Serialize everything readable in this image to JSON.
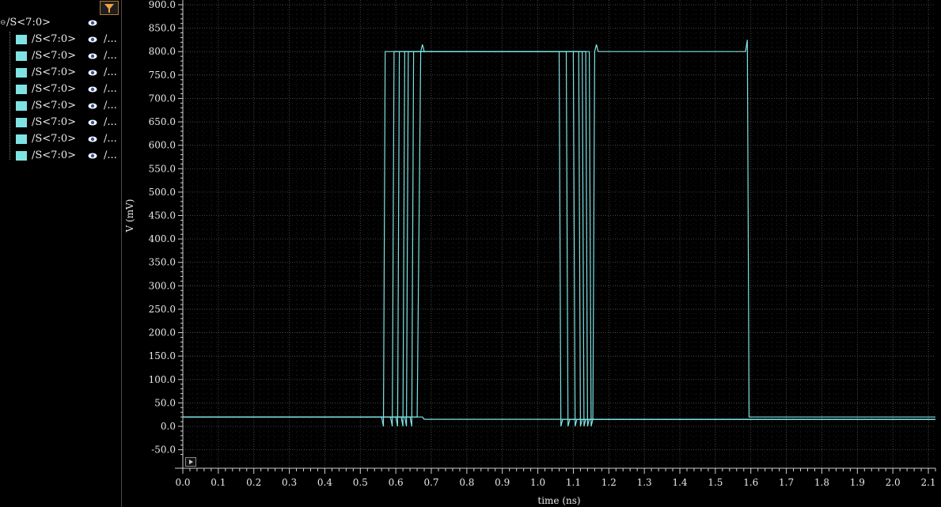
{
  "sidebar": {
    "parent": {
      "label": "/S<7:0>",
      "icon": "eye-icon"
    },
    "children": [
      {
        "label": "/S<7:0>",
        "path": "/...",
        "color": "#7fe3e3"
      },
      {
        "label": "/S<7:0>",
        "path": "/...",
        "color": "#7fe3e3"
      },
      {
        "label": "/S<7:0>",
        "path": "/...",
        "color": "#7fe3e3"
      },
      {
        "label": "/S<7:0>",
        "path": "/...",
        "color": "#7fe3e3"
      },
      {
        "label": "/S<7:0>",
        "path": "/...",
        "color": "#7fe3e3"
      },
      {
        "label": "/S<7:0>",
        "path": "/...",
        "color": "#7fe3e3"
      },
      {
        "label": "/S<7:0>",
        "path": "/...",
        "color": "#7fe3e3"
      },
      {
        "label": "/S<7:0>",
        "path": "/...",
        "color": "#7fe3e3"
      }
    ],
    "filter_icon": "filter-icon"
  },
  "chart_data": {
    "type": "line",
    "title": "",
    "xlabel": "time (ns)",
    "ylabel": "V (mV)",
    "xlim": [
      0.0,
      2.12
    ],
    "ylim": [
      -70,
      905
    ],
    "grid": true,
    "line_color": "#7fe3e3",
    "background": "#000000",
    "x_ticks": [
      0.0,
      0.1,
      0.2,
      0.3,
      0.4,
      0.5,
      0.6,
      0.7,
      0.8,
      0.9,
      1.0,
      1.1,
      1.2,
      1.3,
      1.4,
      1.5,
      1.6,
      1.7,
      1.8,
      1.9,
      2.0,
      2.1
    ],
    "x_tick_labels": [
      "0.0",
      "0.1",
      "0.2",
      "0.3",
      "0.4",
      "0.5",
      "0.6",
      "0.7",
      "0.8",
      "0.9",
      "1.0",
      "1.1",
      "1.2",
      "1.3",
      "1.4",
      "1.5",
      "1.6",
      "1.7",
      "1.8",
      "1.9",
      "2.0",
      "2.1"
    ],
    "y_ticks": [
      -50,
      0,
      50,
      100,
      150,
      200,
      250,
      300,
      350,
      400,
      450,
      500,
      550,
      600,
      650,
      700,
      750,
      800,
      850,
      900
    ],
    "y_tick_labels": [
      "-50.0",
      "0.0",
      "50.0",
      "100.0",
      "150.0",
      "200.0",
      "250.0",
      "300.0",
      "350.0",
      "400.0",
      "450.0",
      "500.0",
      "550.0",
      "600.0",
      "650.0",
      "700.0",
      "750.0",
      "800.0",
      "850.0",
      "900.0"
    ],
    "series": [
      {
        "points": [
          [
            0,
            20
          ],
          [
            0.56,
            20
          ],
          [
            0.565,
            0
          ],
          [
            0.57,
            800
          ],
          [
            1.06,
            800
          ],
          [
            1.065,
            0
          ],
          [
            1.07,
            15
          ],
          [
            2.12,
            15
          ]
        ]
      },
      {
        "points": [
          [
            0,
            20
          ],
          [
            0.585,
            20
          ],
          [
            0.59,
            0
          ],
          [
            0.595,
            800
          ],
          [
            1.08,
            800
          ],
          [
            1.085,
            0
          ],
          [
            1.09,
            15
          ],
          [
            2.12,
            15
          ]
        ]
      },
      {
        "points": [
          [
            0,
            20
          ],
          [
            0.6,
            20
          ],
          [
            0.605,
            0
          ],
          [
            0.61,
            800
          ],
          [
            1.1,
            800
          ],
          [
            1.105,
            0
          ],
          [
            1.11,
            15
          ],
          [
            2.12,
            15
          ]
        ]
      },
      {
        "points": [
          [
            0,
            20
          ],
          [
            0.615,
            20
          ],
          [
            0.62,
            0
          ],
          [
            0.625,
            800
          ],
          [
            1.115,
            800
          ],
          [
            1.12,
            0
          ],
          [
            1.125,
            15
          ],
          [
            2.12,
            15
          ]
        ]
      },
      {
        "points": [
          [
            0,
            20
          ],
          [
            0.625,
            20
          ],
          [
            0.63,
            0
          ],
          [
            0.635,
            800
          ],
          [
            1.125,
            800
          ],
          [
            1.13,
            0
          ],
          [
            1.135,
            15
          ],
          [
            2.12,
            15
          ]
        ]
      },
      {
        "points": [
          [
            0,
            20
          ],
          [
            0.64,
            20
          ],
          [
            0.645,
            0
          ],
          [
            0.65,
            800
          ],
          [
            1.135,
            800
          ],
          [
            1.14,
            0
          ],
          [
            1.145,
            15
          ],
          [
            2.12,
            15
          ]
        ]
      },
      {
        "points": [
          [
            0,
            20
          ],
          [
            0.66,
            20
          ],
          [
            0.67,
            800
          ],
          [
            0.675,
            815
          ],
          [
            0.68,
            800
          ],
          [
            1.145,
            800
          ],
          [
            1.15,
            0
          ],
          [
            1.155,
            15
          ],
          [
            2.12,
            15
          ]
        ]
      },
      {
        "points": [
          [
            0,
            20
          ],
          [
            0.675,
            20
          ],
          [
            0.68,
            15
          ],
          [
            1.155,
            15
          ],
          [
            1.16,
            800
          ],
          [
            1.165,
            815
          ],
          [
            1.17,
            800
          ],
          [
            1.585,
            800
          ],
          [
            1.59,
            825
          ],
          [
            1.595,
            20
          ],
          [
            2.12,
            20
          ]
        ]
      }
    ]
  }
}
